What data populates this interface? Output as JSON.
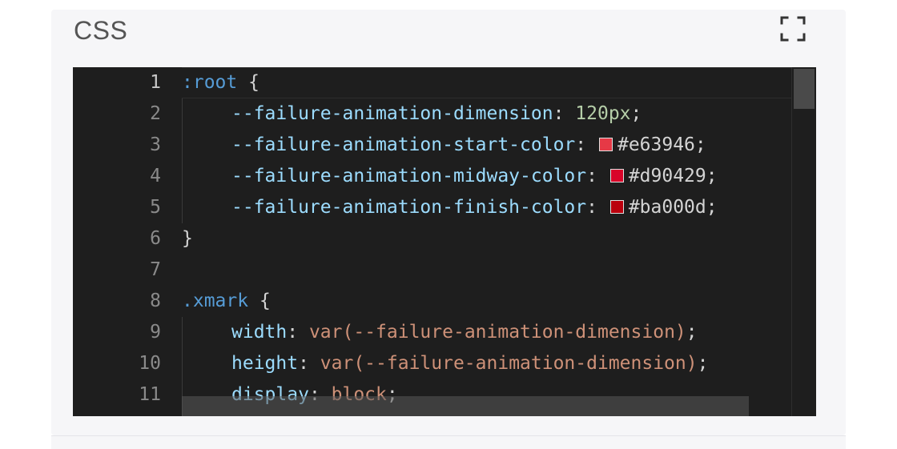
{
  "panel": {
    "title": "CSS",
    "expand_icon": "fullscreen-icon"
  },
  "editor": {
    "language": "css",
    "active_line": 1,
    "colors": {
      "background": "#1e1e1e",
      "selector": "#569cd6",
      "property": "#9cdcfe",
      "number": "#b5cea8",
      "value": "#ce9178"
    },
    "lines": [
      {
        "num": "1",
        "indent": 0,
        "tokens": [
          {
            "t": ":root",
            "c": "sel"
          },
          {
            "t": " {",
            "c": "punc"
          }
        ]
      },
      {
        "num": "2",
        "indent": 1,
        "tokens": [
          {
            "t": "--failure-animation-dimension",
            "c": "prop"
          },
          {
            "t": ": ",
            "c": "punc"
          },
          {
            "t": "120px",
            "c": "num"
          },
          {
            "t": ";",
            "c": "punc"
          }
        ]
      },
      {
        "num": "3",
        "indent": 1,
        "tokens": [
          {
            "t": "--failure-animation-start-color",
            "c": "prop"
          },
          {
            "t": ": ",
            "c": "punc"
          },
          {
            "swatch": "#e63946"
          },
          {
            "t": "#e63946",
            "c": "punc"
          },
          {
            "t": ";",
            "c": "punc"
          }
        ]
      },
      {
        "num": "4",
        "indent": 1,
        "tokens": [
          {
            "t": "--failure-animation-midway-color",
            "c": "prop"
          },
          {
            "t": ": ",
            "c": "punc"
          },
          {
            "swatch": "#d90429"
          },
          {
            "t": "#d90429",
            "c": "punc"
          },
          {
            "t": ";",
            "c": "punc"
          }
        ]
      },
      {
        "num": "5",
        "indent": 1,
        "tokens": [
          {
            "t": "--failure-animation-finish-color",
            "c": "prop"
          },
          {
            "t": ": ",
            "c": "punc"
          },
          {
            "swatch": "#ba000d"
          },
          {
            "t": "#ba000d",
            "c": "punc"
          },
          {
            "t": ";",
            "c": "punc"
          }
        ]
      },
      {
        "num": "6",
        "indent": 0,
        "tokens": [
          {
            "t": "}",
            "c": "punc"
          }
        ]
      },
      {
        "num": "7",
        "indent": 0,
        "tokens": []
      },
      {
        "num": "8",
        "indent": 0,
        "tokens": [
          {
            "t": ".xmark",
            "c": "sel"
          },
          {
            "t": " {",
            "c": "punc"
          }
        ]
      },
      {
        "num": "9",
        "indent": 1,
        "tokens": [
          {
            "t": "width",
            "c": "prop"
          },
          {
            "t": ": ",
            "c": "punc"
          },
          {
            "t": "var(--failure-animation-dimension)",
            "c": "val"
          },
          {
            "t": ";",
            "c": "punc"
          }
        ]
      },
      {
        "num": "10",
        "indent": 1,
        "tokens": [
          {
            "t": "height",
            "c": "prop"
          },
          {
            "t": ": ",
            "c": "punc"
          },
          {
            "t": "var(--failure-animation-dimension)",
            "c": "val"
          },
          {
            "t": ";",
            "c": "punc"
          }
        ]
      },
      {
        "num": "11",
        "indent": 1,
        "tokens": [
          {
            "t": "display",
            "c": "prop"
          },
          {
            "t": ": ",
            "c": "punc"
          },
          {
            "t": "block",
            "c": "val"
          },
          {
            "t": ";",
            "c": "punc"
          }
        ]
      }
    ]
  }
}
